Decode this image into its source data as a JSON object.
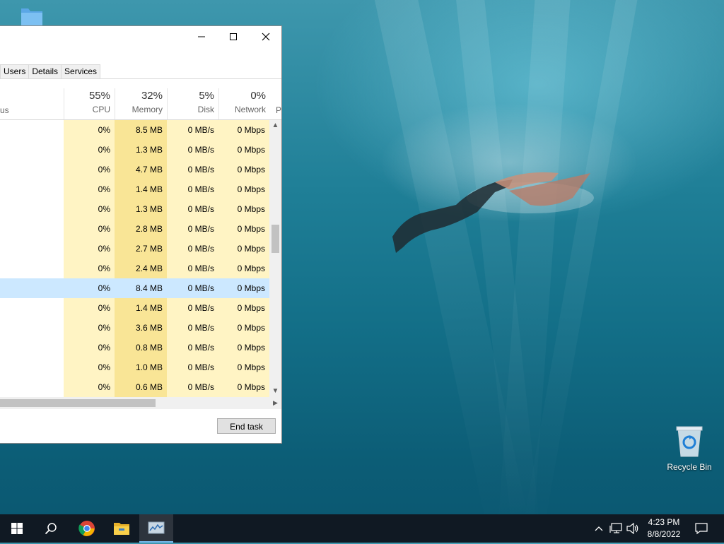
{
  "desktop": {
    "recycle_bin_label": "Recycle Bin"
  },
  "task_manager": {
    "tabs": [
      "Users",
      "Details",
      "Services"
    ],
    "status_header": "us",
    "p_header": "P",
    "columns": [
      {
        "pct": "55%",
        "name": "CPU"
      },
      {
        "pct": "32%",
        "name": "Memory"
      },
      {
        "pct": "5%",
        "name": "Disk"
      },
      {
        "pct": "0%",
        "name": "Network"
      }
    ],
    "rows": [
      {
        "cpu": "0%",
        "mem": "8.5 MB",
        "disk": "0 MB/s",
        "net": "0 Mbps"
      },
      {
        "cpu": "0%",
        "mem": "1.3 MB",
        "disk": "0 MB/s",
        "net": "0 Mbps"
      },
      {
        "cpu": "0%",
        "mem": "4.7 MB",
        "disk": "0 MB/s",
        "net": "0 Mbps"
      },
      {
        "cpu": "0%",
        "mem": "1.4 MB",
        "disk": "0 MB/s",
        "net": "0 Mbps"
      },
      {
        "cpu": "0%",
        "mem": "1.3 MB",
        "disk": "0 MB/s",
        "net": "0 Mbps"
      },
      {
        "cpu": "0%",
        "mem": "2.8 MB",
        "disk": "0 MB/s",
        "net": "0 Mbps"
      },
      {
        "cpu": "0%",
        "mem": "2.7 MB",
        "disk": "0 MB/s",
        "net": "0 Mbps"
      },
      {
        "cpu": "0%",
        "mem": "2.4 MB",
        "disk": "0 MB/s",
        "net": "0 Mbps"
      },
      {
        "cpu": "0%",
        "mem": "8.4 MB",
        "disk": "0 MB/s",
        "net": "0 Mbps",
        "selected": true
      },
      {
        "cpu": "0%",
        "mem": "1.4 MB",
        "disk": "0 MB/s",
        "net": "0 Mbps"
      },
      {
        "cpu": "0%",
        "mem": "3.6 MB",
        "disk": "0 MB/s",
        "net": "0 Mbps"
      },
      {
        "cpu": "0%",
        "mem": "0.8 MB",
        "disk": "0 MB/s",
        "net": "0 Mbps"
      },
      {
        "cpu": "0%",
        "mem": "1.0 MB",
        "disk": "0 MB/s",
        "net": "0 Mbps"
      },
      {
        "cpu": "0%",
        "mem": "0.6 MB",
        "disk": "0 MB/s",
        "net": "0 Mbps"
      }
    ],
    "end_task_label": "End task"
  },
  "taskbar": {
    "apps": [
      "start-icon",
      "search-icon",
      "chrome-icon",
      "file-explorer-icon",
      "task-manager-icon"
    ],
    "active_app": "task-manager-icon",
    "clock_time": "4:23 PM",
    "clock_date": "8/8/2022"
  },
  "colors": {
    "cpu_col_bg": "#fff4c4",
    "mem_col_bg": "#f9e596",
    "selected_row": "#cce8ff",
    "taskbar_bg": "#101923"
  }
}
